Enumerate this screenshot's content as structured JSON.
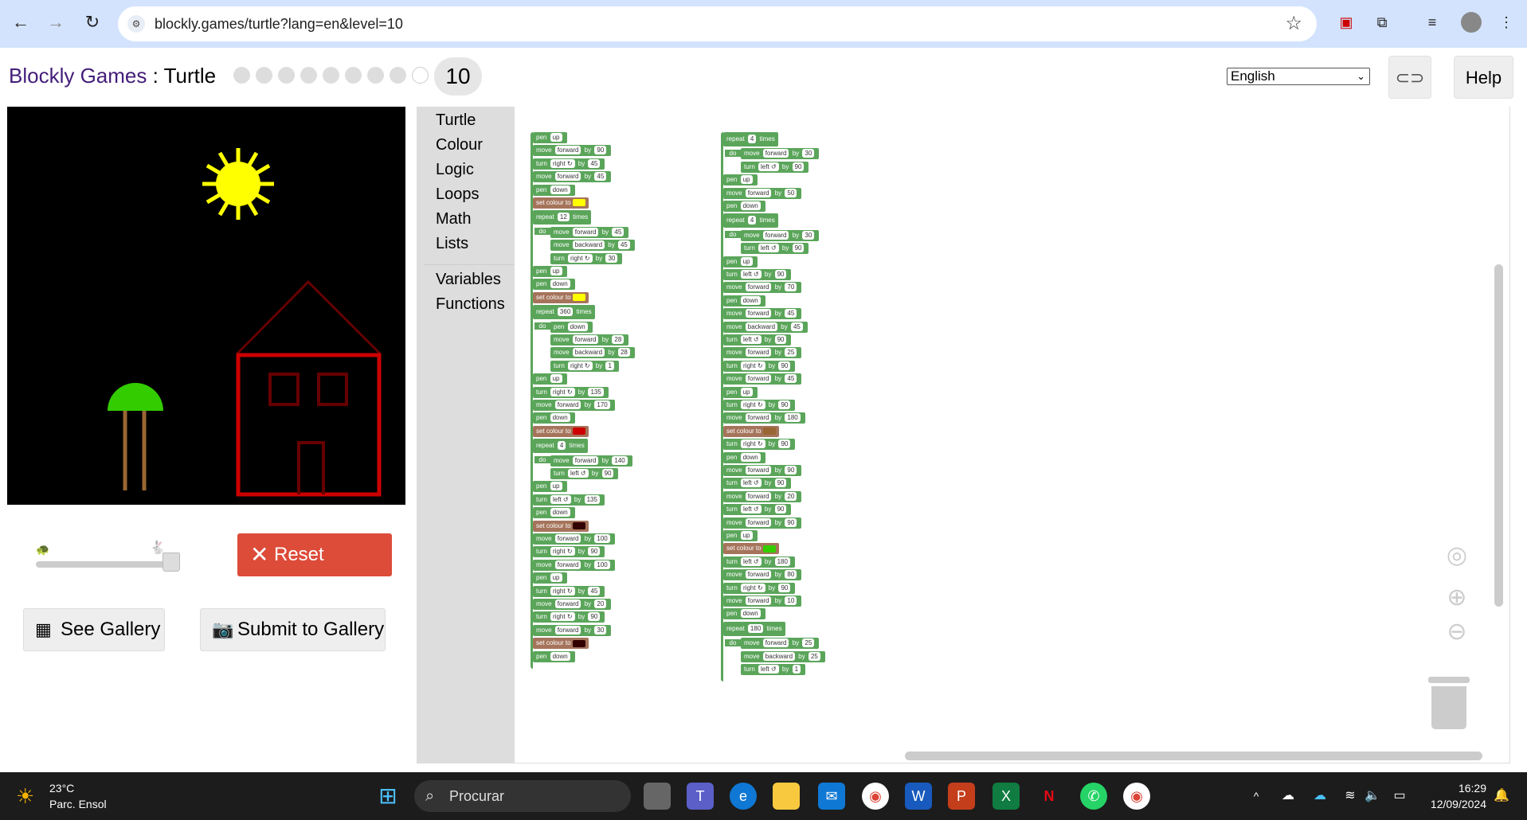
{
  "browser": {
    "url": "blockly.games/turtle?lang=en&level=10"
  },
  "header": {
    "app_name": "Blockly Games",
    "separator": " : ",
    "game_name": "Turtle",
    "level": "10",
    "language": "English",
    "help_label": "Help"
  },
  "controls": {
    "reset_label": "Reset",
    "see_gallery_label": "See Gallery",
    "submit_gallery_label": "Submit to Gallery",
    "speed_level": 1.0
  },
  "toolbox": {
    "items": [
      "Turtle",
      "Colour",
      "Logic",
      "Loops",
      "Math",
      "Lists"
    ],
    "items2": [
      "Variables",
      "Functions"
    ]
  },
  "taskbar": {
    "temperature": "23°C",
    "weather_location": "Parc. Ensol",
    "search_placeholder": "Procurar",
    "time": "16:29",
    "date": "12/09/2024"
  },
  "blocks_col1": [
    {
      "kind": "pen",
      "value": "up",
      "c": "#5ba55b"
    },
    {
      "kind": "move",
      "dir": "forward",
      "n": "90"
    },
    {
      "kind": "turn",
      "dir": "right ↻",
      "n": "45"
    },
    {
      "kind": "move",
      "dir": "forward",
      "n": "45"
    },
    {
      "kind": "pen",
      "value": "down"
    },
    {
      "kind": "colour",
      "swatch": "#ffff00"
    },
    {
      "kind": "repeat",
      "n": "12"
    },
    {
      "kind": "move",
      "dir": "forward",
      "n": "45",
      "in": 1
    },
    {
      "kind": "move",
      "dir": "backward",
      "n": "45",
      "in": 1
    },
    {
      "kind": "turn",
      "dir": "right ↻",
      "n": "30",
      "in": 1
    },
    {
      "kind": "pen",
      "value": "up"
    },
    {
      "kind": "pen",
      "value": "down"
    },
    {
      "kind": "colour",
      "swatch": "#ffff00"
    },
    {
      "kind": "repeat",
      "n": "360"
    },
    {
      "kind": "pen",
      "value": "down",
      "in": 1
    },
    {
      "kind": "move",
      "dir": "forward",
      "n": "28",
      "in": 1
    },
    {
      "kind": "move",
      "dir": "backward",
      "n": "28",
      "in": 1
    },
    {
      "kind": "turn",
      "dir": "right ↻",
      "n": "1",
      "in": 1
    },
    {
      "kind": "pen",
      "value": "up"
    },
    {
      "kind": "turn",
      "dir": "right ↻",
      "n": "135"
    },
    {
      "kind": "move",
      "dir": "forward",
      "n": "170"
    },
    {
      "kind": "pen",
      "value": "down"
    },
    {
      "kind": "colour",
      "swatch": "#cc0000"
    },
    {
      "kind": "repeat",
      "n": "4"
    },
    {
      "kind": "move",
      "dir": "forward",
      "n": "140",
      "in": 1
    },
    {
      "kind": "turn",
      "dir": "left ↺",
      "n": "90",
      "in": 1
    },
    {
      "kind": "pen",
      "value": "up"
    },
    {
      "kind": "turn",
      "dir": "left ↺",
      "n": "135"
    },
    {
      "kind": "pen",
      "value": "down"
    },
    {
      "kind": "colour",
      "swatch": "#330000"
    },
    {
      "kind": "move",
      "dir": "forward",
      "n": "100"
    },
    {
      "kind": "turn",
      "dir": "right ↻",
      "n": "90"
    },
    {
      "kind": "move",
      "dir": "forward",
      "n": "100"
    },
    {
      "kind": "pen",
      "value": "up"
    },
    {
      "kind": "turn",
      "dir": "right ↻",
      "n": "45"
    },
    {
      "kind": "move",
      "dir": "forward",
      "n": "20"
    },
    {
      "kind": "turn",
      "dir": "right ↻",
      "n": "90"
    },
    {
      "kind": "move",
      "dir": "forward",
      "n": "30"
    },
    {
      "kind": "colour",
      "swatch": "#330000"
    },
    {
      "kind": "pen",
      "value": "down"
    }
  ],
  "blocks_col2": [
    {
      "kind": "repeat",
      "n": "4"
    },
    {
      "kind": "move",
      "dir": "forward",
      "n": "30",
      "in": 1
    },
    {
      "kind": "turn",
      "dir": "left ↺",
      "n": "90",
      "in": 1
    },
    {
      "kind": "pen",
      "value": "up"
    },
    {
      "kind": "move",
      "dir": "forward",
      "n": "50"
    },
    {
      "kind": "pen",
      "value": "down"
    },
    {
      "kind": "repeat",
      "n": "4"
    },
    {
      "kind": "move",
      "dir": "forward",
      "n": "30",
      "in": 1
    },
    {
      "kind": "turn",
      "dir": "left ↺",
      "n": "90",
      "in": 1
    },
    {
      "kind": "pen",
      "value": "up"
    },
    {
      "kind": "turn",
      "dir": "left ↺",
      "n": "90"
    },
    {
      "kind": "move",
      "dir": "forward",
      "n": "70"
    },
    {
      "kind": "pen",
      "value": "down"
    },
    {
      "kind": "move",
      "dir": "forward",
      "n": "45"
    },
    {
      "kind": "move",
      "dir": "backward",
      "n": "45"
    },
    {
      "kind": "turn",
      "dir": "left ↺",
      "n": "90"
    },
    {
      "kind": "move",
      "dir": "forward",
      "n": "25"
    },
    {
      "kind": "turn",
      "dir": "right ↻",
      "n": "90"
    },
    {
      "kind": "move",
      "dir": "forward",
      "n": "45"
    },
    {
      "kind": "pen",
      "value": "up"
    },
    {
      "kind": "turn",
      "dir": "right ↻",
      "n": "90"
    },
    {
      "kind": "move",
      "dir": "forward",
      "n": "180"
    },
    {
      "kind": "colour",
      "swatch": "#996633"
    },
    {
      "kind": "turn",
      "dir": "right ↻",
      "n": "90"
    },
    {
      "kind": "pen",
      "value": "down"
    },
    {
      "kind": "move",
      "dir": "forward",
      "n": "90"
    },
    {
      "kind": "turn",
      "dir": "left ↺",
      "n": "90"
    },
    {
      "kind": "move",
      "dir": "forward",
      "n": "20"
    },
    {
      "kind": "turn",
      "dir": "left ↺",
      "n": "90"
    },
    {
      "kind": "move",
      "dir": "forward",
      "n": "90"
    },
    {
      "kind": "pen",
      "value": "up"
    },
    {
      "kind": "colour",
      "swatch": "#33cc00"
    },
    {
      "kind": "turn",
      "dir": "left ↺",
      "n": "180"
    },
    {
      "kind": "move",
      "dir": "forward",
      "n": "80"
    },
    {
      "kind": "turn",
      "dir": "right ↻",
      "n": "90"
    },
    {
      "kind": "move",
      "dir": "forward",
      "n": "10"
    },
    {
      "kind": "pen",
      "value": "down"
    },
    {
      "kind": "repeat",
      "n": "180"
    },
    {
      "kind": "move",
      "dir": "forward",
      "n": "25",
      "in": 1
    },
    {
      "kind": "move",
      "dir": "backward",
      "n": "25",
      "in": 1
    },
    {
      "kind": "turn",
      "dir": "left ↺",
      "n": "1",
      "in": 1
    }
  ],
  "block_words": {
    "pen": "pen",
    "move": "move",
    "turn": "turn",
    "by": "by",
    "set_colour": "set colour to",
    "repeat": "repeat",
    "times": "times",
    "do": "do"
  },
  "colors": {
    "turtle_block": "#5ba55b",
    "colour_block": "#a5745b",
    "reset": "#dd4b39",
    "title_purple": "#441d7a"
  }
}
